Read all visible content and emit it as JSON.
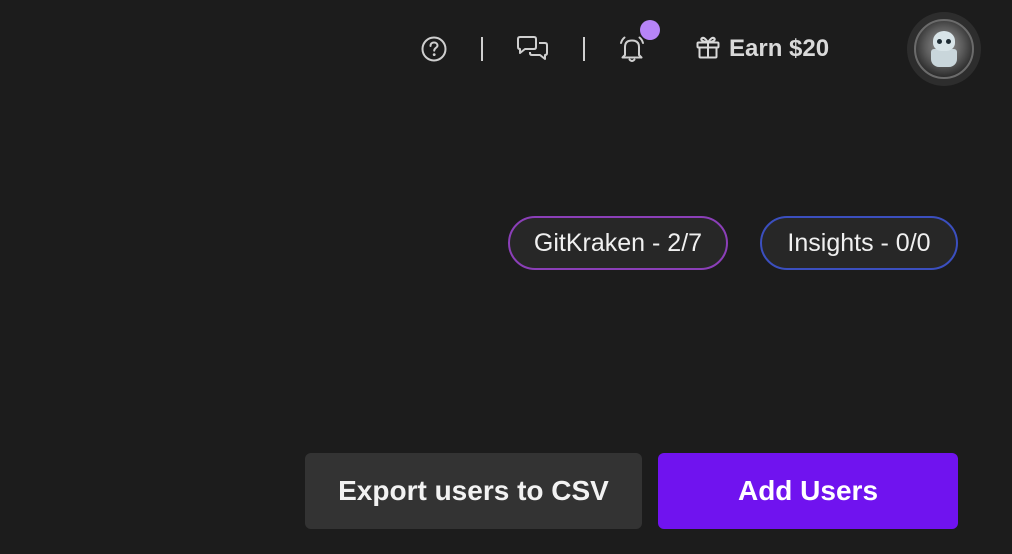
{
  "topbar": {
    "help_icon": "help-circle-icon",
    "chat_icon": "chat-bubbles-icon",
    "bell_icon": "bell-icon",
    "gift_icon": "gift-icon",
    "earn_label": "Earn $20",
    "notification_dot_color": "#b784f7"
  },
  "licenses": {
    "gitkraken": {
      "label": "GitKraken - 2/7",
      "border_color": "#8b3fb8"
    },
    "insights": {
      "label": "Insights - 0/0",
      "border_color": "#3b4fbf"
    }
  },
  "actions": {
    "export_label": "Export users to CSV",
    "add_label": "Add Users",
    "add_color": "#7013ef"
  }
}
